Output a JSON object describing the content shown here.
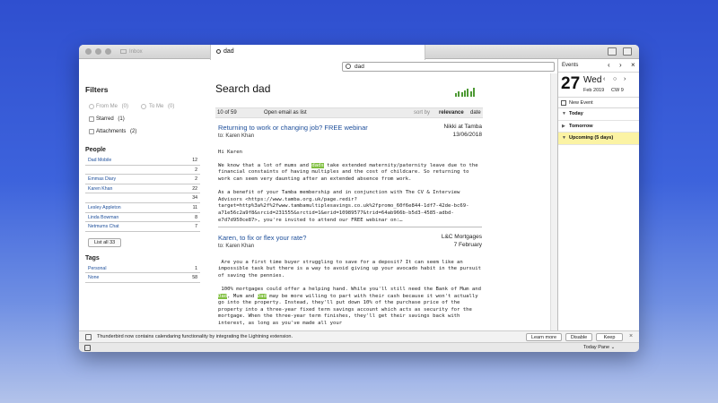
{
  "tabs": [
    {
      "label": "Inbox",
      "active": false
    },
    {
      "label": "dad",
      "active": true
    }
  ],
  "search": {
    "value": "dad"
  },
  "filters": {
    "heading": "Filters",
    "from_me": {
      "label": "From Me",
      "count": "(0)"
    },
    "to_me": {
      "label": "To Me",
      "count": "(0)"
    },
    "starred": {
      "label": "Starred",
      "count": "(1)"
    },
    "attachments": {
      "label": "Attachments",
      "count": "(2)"
    }
  },
  "people": {
    "heading": "People",
    "items": [
      {
        "name": "Dad Mobile",
        "count": "12"
      },
      {
        "name": "",
        "count": "2"
      },
      {
        "name": "Emmas Diary",
        "count": "2"
      },
      {
        "name": "Karen Khan",
        "count": "22"
      },
      {
        "name": "",
        "count": "34"
      },
      {
        "name": "Lesley Appleton",
        "count": "11"
      },
      {
        "name": "Linda Bowman",
        "count": "8"
      },
      {
        "name": "Netmums Chat",
        "count": "7"
      }
    ],
    "list_all_label": "List all 33"
  },
  "tags": {
    "heading": "Tags",
    "items": [
      {
        "name": "Personal",
        "count": "1"
      },
      {
        "name": "None",
        "count": "58"
      }
    ]
  },
  "results": {
    "title": "Search dad",
    "count_label": "10 of 59",
    "open_label": "Open email as list",
    "sort_by_label": "sort by",
    "sort_relevance": "relevance",
    "sort_date": "date",
    "histogram": [
      3,
      5,
      4,
      6,
      7,
      5,
      8
    ],
    "messages": [
      {
        "subject": "Returning to work or changing job? FREE webinar",
        "to": "to: Karen Khan",
        "from": "Nikki at Tamba",
        "date": "13/06/2018",
        "body_pre": "‌\nHi Karen\n\nWe know that a lot of mums and ",
        "body_hl1": "dads",
        "body_post": " take extended maternity/paternity leave due to the financial constaints of having multiples and the cost of childcare. So returning to work can seem very daunting after an extended absence from work.\n\nAs a benefit of your Tamba membership and in conjunction with The CV & Interview Advisors <https://www.tamba.org.uk/page.redir?target=http%3a%2f%2fwww.tambamultiplesavings.co.uk%2fpromo_60f6e844-1df7-42de-bc69-a71e56c2a9f8&srcid=231555&srctid=1&erid=10989577&trid=64ab966b-b5d3-4585-adbd-e7d7d950ce87>, you're invited to attend our FREE webinar on:…"
      },
      {
        "subject": "Karen, to fix or flex your rate?",
        "to": "to: Karen Khan",
        "from": "L&C Mortgages",
        "date": "7 February",
        "body_pre": "‌\n Are you a first time buyer struggling to save for a deposit? It can seem like an impossible task but there is a way to avoid giving up your avocado habit in the pursuit of saving the pennies.\n\n 100% mortgages could offer a helping hand. While you'll still need the Bank of Mum and ",
        "body_hl1": "Dad",
        "body_mid": ", Mum and ",
        "body_hl2": "Dad",
        "body_post": " may be more willing to part with their cash because it won't actually go into the property. Instead, they'll put down 10% of the purchase price of the property into a three-year fixed term savings account which acts as security for the mortgage. When the three-year term finishes, they'll get their savings back with interest, as long as you've made all your"
      }
    ]
  },
  "notification": {
    "text": "Thunderbird now contains calendaring functionality by integrating the Lightning extension.",
    "learn_more": "Learn more",
    "disable": "Disable",
    "keep": "Keep",
    "close": "×"
  },
  "today_pane": {
    "header": "Events",
    "day_number": "27",
    "weekday": "Wed",
    "month_year": "Feb 2019",
    "calendar_week": "CW 9",
    "new_event": "New Event",
    "agenda": [
      {
        "label": "Today",
        "expanded": true
      },
      {
        "label": "Tomorrow",
        "expanded": false
      },
      {
        "label": "Upcoming (5 days)",
        "expanded": true
      }
    ],
    "status_label": "Today Pane"
  },
  "colors": {
    "accent_link": "#1d4e9a",
    "highlight": "#7fbf3f",
    "upcoming_bg": "#fbf3a4"
  }
}
